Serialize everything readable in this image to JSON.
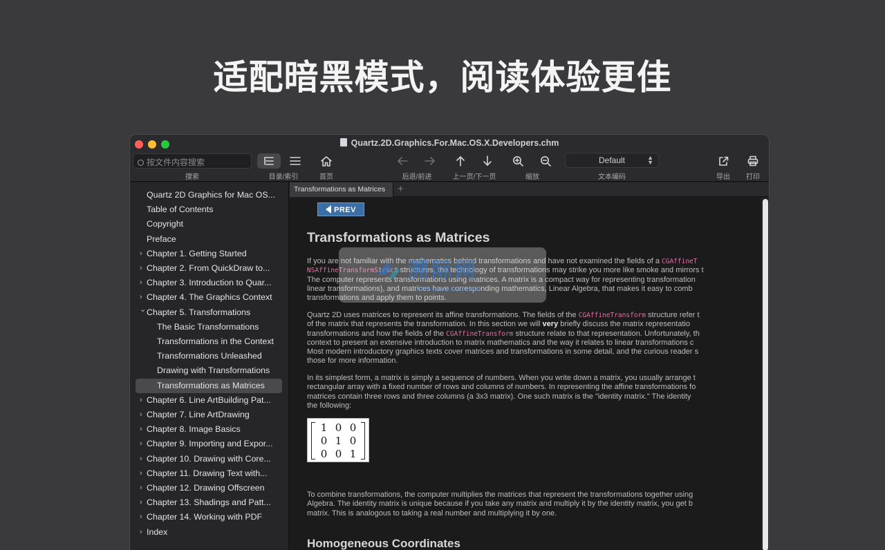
{
  "headline": "适配暗黑模式，阅读体验更佳",
  "window": {
    "title": "Quartz.2D.Graphics.For.Mac.OS.X.Developers.chm"
  },
  "toolbar": {
    "search_placeholder": "按文件内容搜索",
    "search_label": "搜索",
    "toc_label": "目录/索引",
    "home_label": "首页",
    "backforward_label": "后退/前进",
    "page_label": "上一页/下一页",
    "zoom_label": "缩放",
    "encoding_value": "Default",
    "encoding_label": "文本编码",
    "export_label": "导出",
    "print_label": "打印"
  },
  "sidebar": {
    "items": [
      {
        "label": "Quartz 2D Graphics for Mac OS...",
        "level": 0,
        "expandable": false
      },
      {
        "label": "Table of Contents",
        "level": 0,
        "expandable": false
      },
      {
        "label": "Copyright",
        "level": 0,
        "expandable": false
      },
      {
        "label": "Preface",
        "level": 0,
        "expandable": false
      },
      {
        "label": "Chapter 1.  Getting Started",
        "level": 0,
        "expandable": true
      },
      {
        "label": "Chapter 2.  From QuickDraw to...",
        "level": 0,
        "expandable": true
      },
      {
        "label": "Chapter 3.  Introduction to Quar...",
        "level": 0,
        "expandable": true
      },
      {
        "label": "Chapter 4.  The Graphics Context",
        "level": 0,
        "expandable": true
      },
      {
        "label": "Chapter 5.  Transformations",
        "level": 0,
        "expandable": true,
        "expanded": true
      },
      {
        "label": "The Basic Transformations",
        "level": 1
      },
      {
        "label": "Transformations in the Context",
        "level": 1
      },
      {
        "label": "Transformations Unleashed",
        "level": 1
      },
      {
        "label": "Drawing with Transformations",
        "level": 1
      },
      {
        "label": "Transformations as Matrices",
        "level": 1,
        "selected": true
      },
      {
        "label": "Chapter 6.  Line ArtBuilding Pat...",
        "level": 0,
        "expandable": true
      },
      {
        "label": "Chapter 7.  Line ArtDrawing",
        "level": 0,
        "expandable": true
      },
      {
        "label": "Chapter 8.  Image Basics",
        "level": 0,
        "expandable": true
      },
      {
        "label": "Chapter 9.  Importing and Expor...",
        "level": 0,
        "expandable": true
      },
      {
        "label": "Chapter 10.  Drawing with Core...",
        "level": 0,
        "expandable": true
      },
      {
        "label": "Chapter 11.  Drawing Text with...",
        "level": 0,
        "expandable": true
      },
      {
        "label": "Chapter 12.  Drawing Offscreen",
        "level": 0,
        "expandable": true
      },
      {
        "label": "Chapter 13.  Shadings and Patt...",
        "level": 0,
        "expandable": true
      },
      {
        "label": "Chapter 14.  Working with PDF",
        "level": 0,
        "expandable": true
      },
      {
        "label": "Index",
        "level": 0,
        "expandable": true
      }
    ]
  },
  "tabs": {
    "active": "Transformations as Matrices",
    "add": "+"
  },
  "content": {
    "prev_label": "PREV",
    "title": "Transformations as Matrices",
    "p1_l1a": "If you are not familiar with the mathematics behind transformations and have not examined the fields of a ",
    "p1_l1_code": "CGAffineT",
    "p1_l2_code": "NSAffineTransformStruct",
    "p1_l2b": " structures, the technology of transformations may strike you more like smoke and mirrors t",
    "p1_l3": "The computer represents transformations using matrices. A matrix is a compact way for representing transformation",
    "p1_l4": "linear transformations), and matrices have corresponding mathematics, Linear Algebra, that makes it easy to comb",
    "p1_l5": "transformations and apply them to points.",
    "p2_l1a": "Quartz 2D uses matrices to represent its affine transformations. The fields of the ",
    "p2_l1_code": "CGAffineTransform",
    "p2_l1b": " structure refer t",
    "p2_l2a": "of the matrix that represents the transformation. In this section we will ",
    "p2_l2_bold": "very",
    "p2_l2b": " briefly discuss the matrix representatio",
    "p2_l3a": "transformations and how the fields of the ",
    "p2_l3_code": "CGAffineTransform",
    "p2_l3b": " structure relate to that representation. Unfortunately, th",
    "p2_l4": "context to present an extensive introduction to matrix mathematics and the way it relates to linear transformations c",
    "p2_l5": "Most modern introductory graphics texts cover matrices and transformations in some detail, and the curious reader s",
    "p2_l6": "those for more information.",
    "p3_l1": "In its simplest form, a matrix is simply a sequence of numbers. When you write down a matrix, you usually arrange t",
    "p3_l2": "rectangular array with a fixed number of rows and columns of numbers. In representing the affine transformations fo",
    "p3_l3": "matrices contain three rows and three columns (a 3x3 matrix). One such matrix is the \"identity matrix.\" The identity",
    "p3_l4": "the following:",
    "matrix": [
      [
        "1",
        "0",
        "0"
      ],
      [
        "0",
        "1",
        "0"
      ],
      [
        "0",
        "0",
        "1"
      ]
    ],
    "p4_l1": "To combine transformations, the computer multiplies the matrices that represent the transformations together using",
    "p4_l2": "Algebra. The identity matrix is unique because if you take any matrix and multiply it by the identity matrix, you get b",
    "p4_l3": "matrix. This is analogous to taking a real number and multiplying it by one.",
    "subtitle": "Homogeneous Coordinates"
  },
  "watermark": {
    "text": "溯际网",
    "sub": "www.sujiwang.com"
  }
}
